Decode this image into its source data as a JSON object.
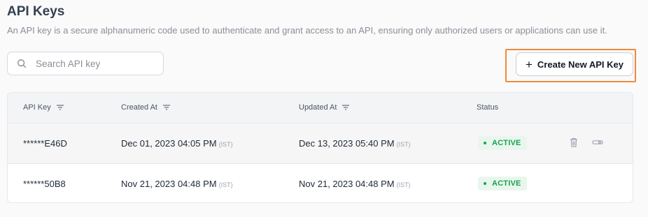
{
  "page": {
    "title": "API Keys",
    "description": "An API key is a secure alphanumeric code used to authenticate and grant access to an API, ensuring only authorized users or applications can use it."
  },
  "search": {
    "placeholder": "Search API key",
    "value": ""
  },
  "create_button": {
    "label": "Create New API Key",
    "icon": "plus-icon"
  },
  "table": {
    "columns": [
      "API Key",
      "Created At",
      "Updated At",
      "Status"
    ],
    "rows": [
      {
        "key": "******E46D",
        "created": "Dec 01, 2023 04:05 PM",
        "created_tz": "(IST)",
        "updated": "Dec 13, 2023 05:40 PM",
        "updated_tz": "(IST)",
        "status": "ACTIVE"
      },
      {
        "key": "******50B8",
        "created": "Nov 21, 2023 04:48 PM",
        "created_tz": "(IST)",
        "updated": "Nov 21, 2023 04:48 PM",
        "updated_tz": "(IST)",
        "status": "ACTIVE"
      }
    ]
  },
  "colors": {
    "accent_highlight": "#ef8a3c",
    "status_active": "#16a34a",
    "status_active_bg": "#e9f6ee"
  },
  "icons": [
    "search-icon",
    "plus-icon",
    "filter-icon",
    "trash-icon",
    "key-icon"
  ]
}
